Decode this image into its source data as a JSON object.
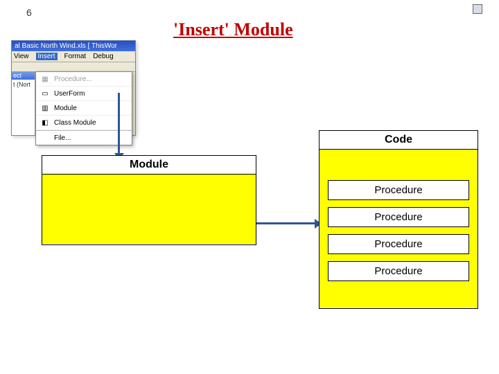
{
  "slide": {
    "number": "6"
  },
  "title": "'Insert' Module",
  "vba": {
    "title": "al Basic   North Wind.xls   [ ThisWor",
    "menu": {
      "view": "View",
      "insert": "Insert",
      "format": "Format",
      "debug": "Debug"
    },
    "project_header": "ect",
    "project_item": "t (Nort",
    "dropdown": {
      "procedure": "Procedure...",
      "userform": "UserForm",
      "module": "Module",
      "classmodule": "Class Module",
      "file": "File..."
    }
  },
  "diagram": {
    "module_label": "Module",
    "code_label": "Code",
    "procedures": [
      "Procedure",
      "Procedure",
      "Procedure",
      "Procedure"
    ]
  }
}
